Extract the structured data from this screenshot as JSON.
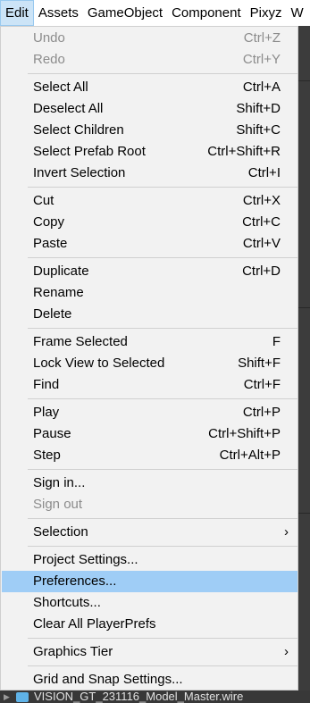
{
  "menubar": {
    "items": [
      "Edit",
      "Assets",
      "GameObject",
      "Component",
      "Pixyz",
      "W"
    ]
  },
  "menu": {
    "groups": [
      [
        {
          "label": "Undo",
          "shortcut": "Ctrl+Z",
          "disabled": true
        },
        {
          "label": "Redo",
          "shortcut": "Ctrl+Y",
          "disabled": true
        }
      ],
      [
        {
          "label": "Select All",
          "shortcut": "Ctrl+A"
        },
        {
          "label": "Deselect All",
          "shortcut": "Shift+D"
        },
        {
          "label": "Select Children",
          "shortcut": "Shift+C"
        },
        {
          "label": "Select Prefab Root",
          "shortcut": "Ctrl+Shift+R"
        },
        {
          "label": "Invert Selection",
          "shortcut": "Ctrl+I"
        }
      ],
      [
        {
          "label": "Cut",
          "shortcut": "Ctrl+X"
        },
        {
          "label": "Copy",
          "shortcut": "Ctrl+C"
        },
        {
          "label": "Paste",
          "shortcut": "Ctrl+V"
        }
      ],
      [
        {
          "label": "Duplicate",
          "shortcut": "Ctrl+D"
        },
        {
          "label": "Rename",
          "shortcut": ""
        },
        {
          "label": "Delete",
          "shortcut": ""
        }
      ],
      [
        {
          "label": "Frame Selected",
          "shortcut": "F"
        },
        {
          "label": "Lock View to Selected",
          "shortcut": "Shift+F"
        },
        {
          "label": "Find",
          "shortcut": "Ctrl+F"
        }
      ],
      [
        {
          "label": "Play",
          "shortcut": "Ctrl+P"
        },
        {
          "label": "Pause",
          "shortcut": "Ctrl+Shift+P"
        },
        {
          "label": "Step",
          "shortcut": "Ctrl+Alt+P"
        }
      ],
      [
        {
          "label": "Sign in...",
          "shortcut": ""
        },
        {
          "label": "Sign out",
          "shortcut": "",
          "disabled": true
        }
      ],
      [
        {
          "label": "Selection",
          "shortcut": "",
          "submenu": true
        }
      ],
      [
        {
          "label": "Project Settings...",
          "shortcut": ""
        },
        {
          "label": "Preferences...",
          "shortcut": "",
          "highlighted": true
        },
        {
          "label": "Shortcuts...",
          "shortcut": ""
        },
        {
          "label": "Clear All PlayerPrefs",
          "shortcut": ""
        }
      ],
      [
        {
          "label": "Graphics Tier",
          "shortcut": "",
          "submenu": true
        }
      ],
      [
        {
          "label": "Grid and Snap Settings...",
          "shortcut": ""
        }
      ]
    ]
  },
  "hierarchy_row": {
    "name": "VISION_GT_231116_Model_Master.wire"
  },
  "colors": {
    "highlight": "#9fcdf6",
    "active_menu": "#cce4f7",
    "menu_bg": "#f2f2f2",
    "disabled_text": "#8c8c8c"
  }
}
